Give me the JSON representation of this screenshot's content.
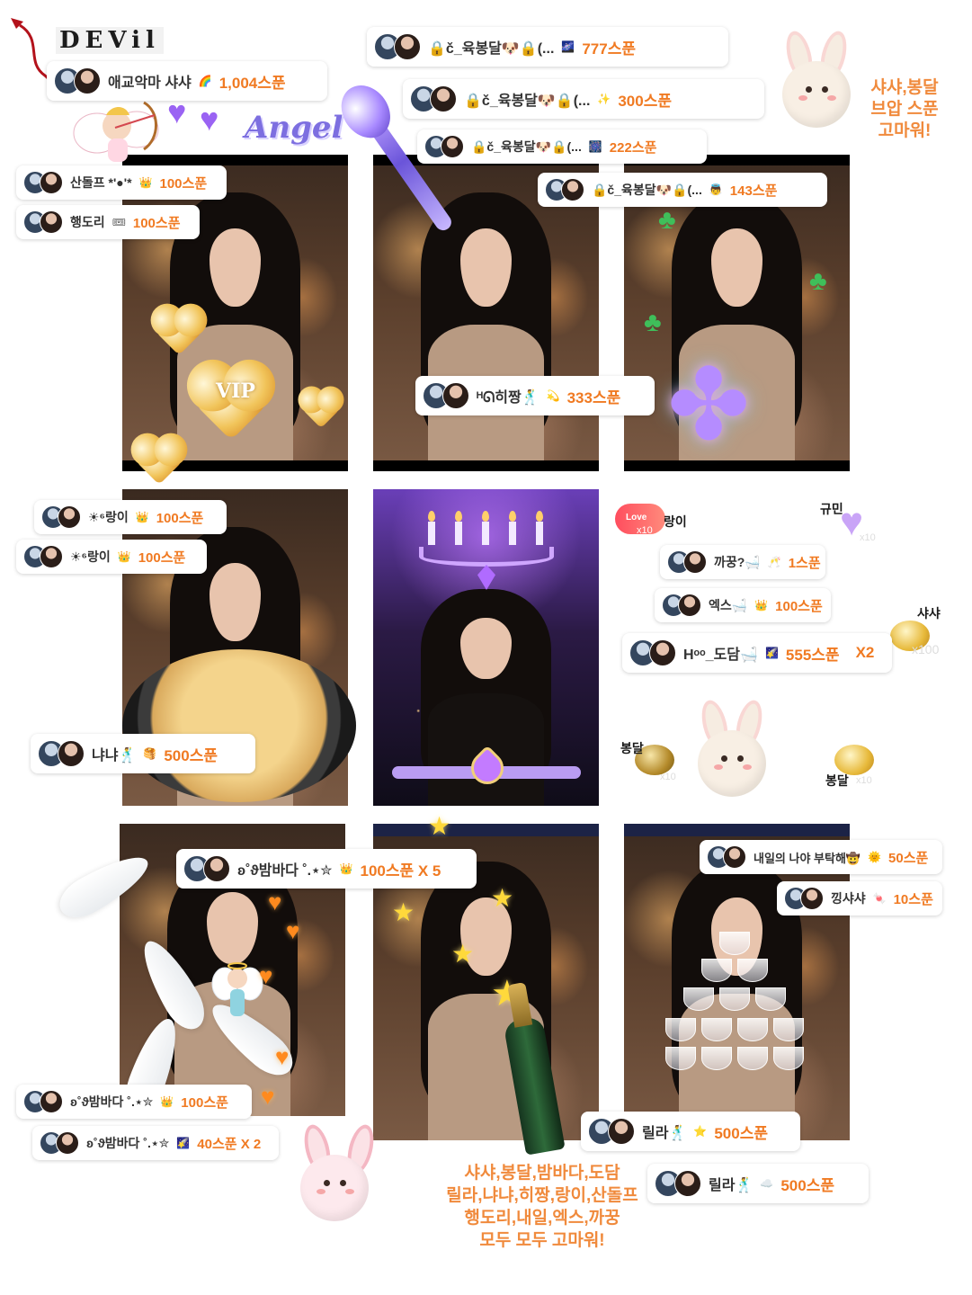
{
  "header": {
    "devil_label": "DEVil",
    "angel_label": "Angel"
  },
  "top_thanks": "샤샤,봉달\n브압 스푼\n고마워!",
  "bottom_thanks": "샤샤,봉달,밤바다,도담\n릴라,냐냐,히짱,랑이,산돌프\n행도리,내일,엑스,까꿍\n모두 모두 고마워!",
  "donations": [
    {
      "id": "d1",
      "name": "애교악마 샤샤",
      "icon": "rainbow-gift-icon",
      "amount": "1,004스푼"
    },
    {
      "id": "d2",
      "name": "🔒č_육봉달🐶🔒(...",
      "icon": "purple-gift-icon",
      "amount": "777스푼"
    },
    {
      "id": "d3",
      "name": "🔒č_육봉달🐶🔒(...",
      "icon": "wand-gift-icon",
      "amount": "300스푼"
    },
    {
      "id": "d4",
      "name": "🔒č_육봉달🐶🔒(...",
      "icon": "firework-gift-icon",
      "amount": "222스푼"
    },
    {
      "id": "d5",
      "name": "🔒č_육봉달🐶🔒(...",
      "icon": "angel-gift-icon",
      "amount": "143스푼"
    },
    {
      "id": "d6",
      "name": "산돌프 *'●'*",
      "icon": "crown-gift-icon",
      "amount": "100스푼"
    },
    {
      "id": "d7",
      "name": "행도리",
      "icon": "ticket-gift-icon",
      "amount": "100스푼"
    },
    {
      "id": "d8",
      "name": "ᴴᘏ히짱🕺",
      "icon": "sparkle-gift-icon",
      "amount": "333스푼"
    },
    {
      "id": "d9",
      "name": "☀︎⁶랑이",
      "icon": "crown-gift-icon",
      "amount": "100스푼"
    },
    {
      "id": "d10",
      "name": "☀︎⁶랑이",
      "icon": "crown-gift-icon",
      "amount": "100스푼"
    },
    {
      "id": "d11",
      "name": "냐냐🕺",
      "icon": "pancake-gift-icon",
      "amount": "500스푼"
    },
    {
      "id": "d12",
      "name": "까꿍?🛁",
      "icon": "drink-gift-icon",
      "amount": "1스푼"
    },
    {
      "id": "d13",
      "name": "엑스🛁",
      "icon": "crown-gift-icon",
      "amount": "100스푼"
    },
    {
      "id": "d14",
      "name": "Hᵒᵒ_도담🛁",
      "icon": "starry-gift-icon",
      "amount": "555스푼",
      "suffix": "X2"
    },
    {
      "id": "d15",
      "name": "ʚ˚ϑ밤바다 ˚.⋆✮",
      "icon": "crown-gift-icon",
      "amount": "100스푼 X 5"
    },
    {
      "id": "d16",
      "name": "내일의 나야 부탁해🤠",
      "icon": "sun-gift-icon",
      "amount": "50스푼"
    },
    {
      "id": "d17",
      "name": "낑샤샤",
      "icon": "candy-gift-icon",
      "amount": "10스푼"
    },
    {
      "id": "d18",
      "name": "ʚ˚ϑ밤바다 ˚.⋆✮",
      "icon": "crown-gift-icon",
      "amount": "100스푼"
    },
    {
      "id": "d19",
      "name": "ʚ˚ϑ밤바다 ˚.⋆✮",
      "icon": "shooting-star-gift-icon",
      "amount": "40스푼 X 2"
    },
    {
      "id": "d20",
      "name": "릴라🕺",
      "icon": "star-gift-icon",
      "amount": "500스푼"
    },
    {
      "id": "d21",
      "name": "릴라🕺",
      "icon": "sky-gift-icon",
      "amount": "500스푼"
    }
  ],
  "stickers": {
    "rangi": "랑이",
    "rangi_count": "x10",
    "gyumin": "규민",
    "gyumin_count": "x10",
    "shasha": "샤샤",
    "shasha_count": "x100",
    "bongdal_rose": "봉달",
    "bongdal_rose_count": "x10",
    "bongdal_vip": "봉달",
    "bongdal_vip_count": "x10",
    "vip_label": "VIP",
    "heart_badge": "Love"
  }
}
